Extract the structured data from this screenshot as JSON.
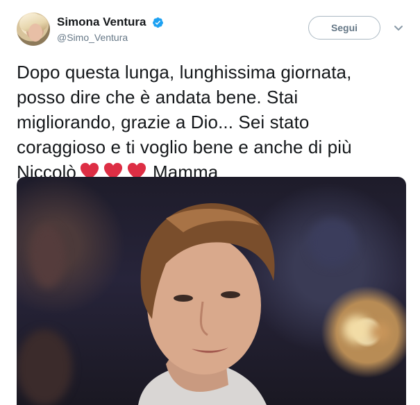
{
  "user": {
    "display_name": "Simona Ventura",
    "handle": "@Simo_Ventura",
    "verified": true
  },
  "follow_button": {
    "label": "Segui"
  },
  "tweet": {
    "line1": "Dopo questa lunga, lunghissima giornata,",
    "line2": "posso dire che è andata bene. Stai",
    "line3": "migliorando, grazie a Dio... Sei stato",
    "line4": "coraggioso e ti voglio bene e anche di più",
    "line5_start": "Niccolò",
    "line5_end": "Mamma",
    "hearts_count": 3
  },
  "icons": {
    "verified": "verified-badge-icon",
    "caret": "chevron-down-icon",
    "heart": "red-heart-emoji-icon"
  },
  "colors": {
    "name": "#14171a",
    "handle": "#657786",
    "verified": "#1da1f2",
    "heart": "#e0245e",
    "button_border": "#aab8c2"
  }
}
